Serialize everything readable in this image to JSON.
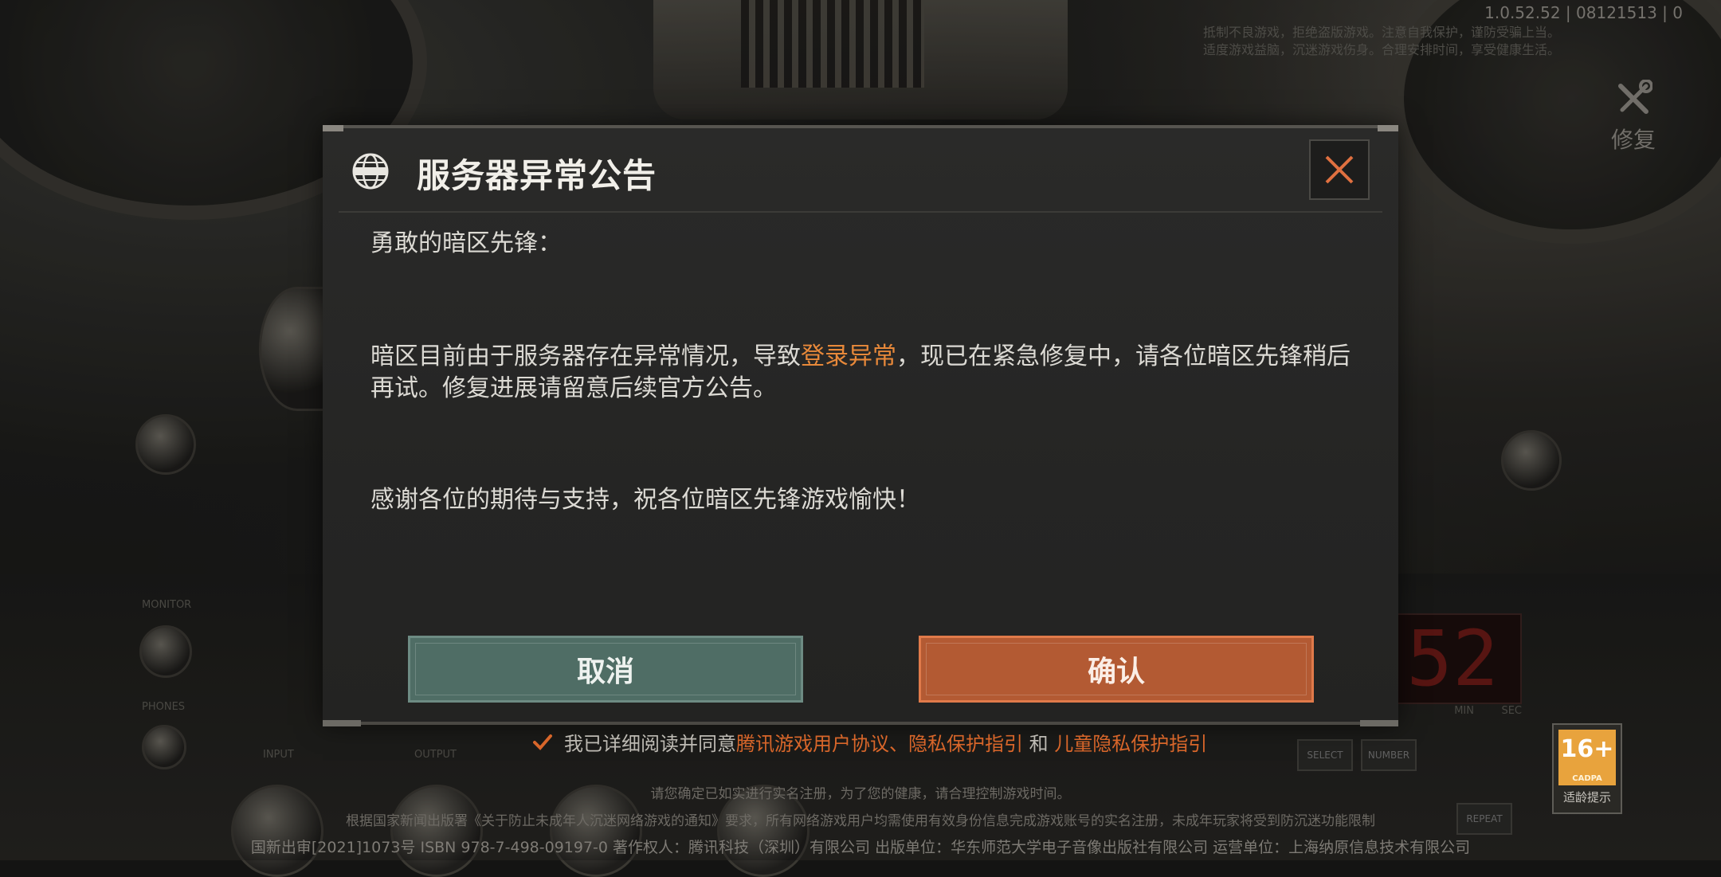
{
  "version_info": "1.0.52.52 | 08121513 | 0",
  "anti_addiction": [
    "抵制不良游戏，拒绝盗版游戏。注意自我保护，谨防受骗上当。",
    "适度游戏益脑，沉迷游戏伤身。合理安排时间，享受健康生活。"
  ],
  "repair_label": "修复",
  "dialog": {
    "title": "服务器异常公告",
    "greeting": "勇敢的暗区先锋：",
    "body_before": "暗区目前由于服务器存在异常情况，导致",
    "body_highlight": "登录异常",
    "body_after": "，现已在紧急修复中，请各位暗区先锋稍后再试。修复进展请留意后续官方公告。",
    "thanks": "感谢各位的期待与支持，祝各位暗区先锋游戏愉快！",
    "cancel_label": "取消",
    "confirm_label": "确认",
    "highlight_color": "#e8893a"
  },
  "agreement": {
    "prefix": "我已详细阅读并同意",
    "link1": "腾讯游戏用户协议",
    "sep1": "、",
    "link2": "隐私保护指引",
    "and": " 和 ",
    "link3": "儿童隐私保护指引",
    "checked": true
  },
  "notice_line1": "请您确定已如实进行实名注册，为了您的健康，请合理控制游戏时间。",
  "notice_line2": "根据国家新闻出版署《关于防止未成年人沉迷网络游戏的通知》要求，所有网络游戏用户均需使用有效身份信息完成游戏账号的实名注册，未成年玩家将受到防沉迷功能限制",
  "footer": "国新出审[2021]1073号  ISBN 978-7-498-09197-0  著作权人：腾讯科技（深圳）有限公司  出版单位：华东师范大学电子音像出版社有限公司  运营单位：上海纳原信息技术有限公司",
  "age_rating": {
    "value": "16+",
    "org": "CADPA",
    "caption": "适龄提示"
  },
  "background_labels": {
    "led": "52",
    "input": "INPUT",
    "output": "OUTPUT",
    "phones": "PHONES",
    "monitor": "MONITOR",
    "select": "SELECT",
    "number": "NUMBER",
    "repeat": "REPEAT",
    "min": "MIN",
    "sec": "SEC"
  }
}
